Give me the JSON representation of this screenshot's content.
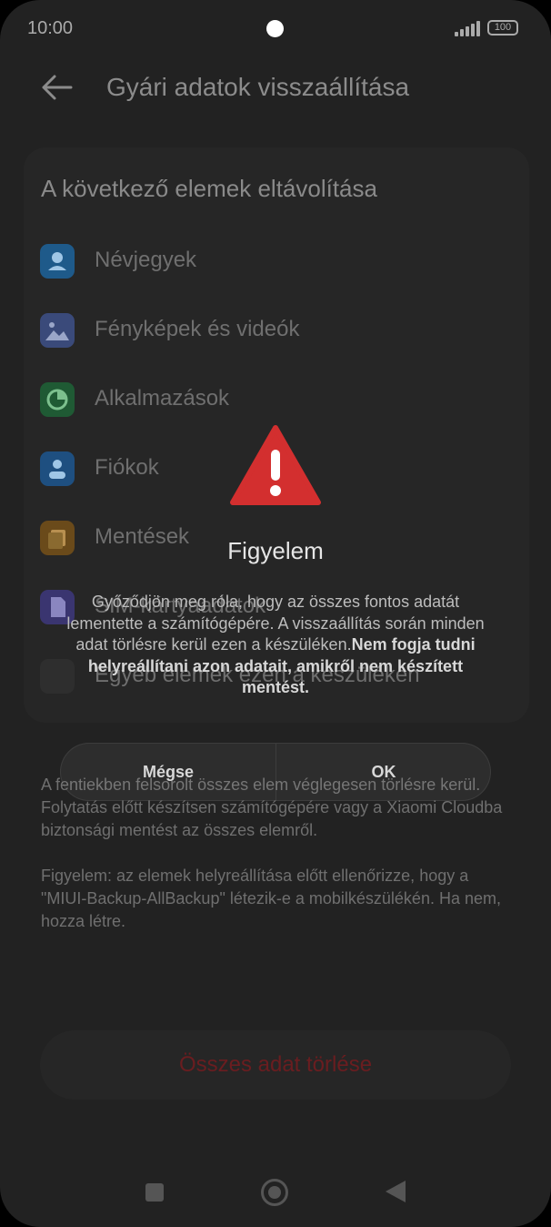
{
  "status_bar": {
    "time": "10:00",
    "battery": "100"
  },
  "header": {
    "title": "Gyári adatok visszaállítása"
  },
  "card": {
    "title": "A következő elemek eltávolítása",
    "items": [
      {
        "label": "Névjegyek",
        "icon": "contacts-icon",
        "color": "#1e5a8a"
      },
      {
        "label": "Fényképek és videók",
        "icon": "gallery-icon",
        "color": "#3a4a7a"
      },
      {
        "label": "Alkalmazások",
        "icon": "apps-icon",
        "color": "#1f5a34"
      },
      {
        "label": "Fiókok",
        "icon": "account-icon",
        "color": "#1e4f80"
      },
      {
        "label": "Mentések",
        "icon": "backup-icon",
        "color": "#6a4a1a"
      },
      {
        "label": "SIM-kártyaadatok",
        "icon": "sim-icon",
        "color": "#3a3570"
      },
      {
        "label": "Egyéb elemek ezen a készüléken",
        "icon": "other-icon",
        "color": "#2e2e2e"
      }
    ]
  },
  "info": {
    "p1": "A fentiekben felsorolt összes elem véglegesen törlésre kerül. Folytatás előtt készítsen számítógépére vagy a Xiaomi Cloudba biztonsági mentést az összes elemről.",
    "p2": "Figyelem: az elemek helyreállítása előtt ellenőrizze, hogy a \"MIUI-Backup-AllBackup\" létezik-e a mobilkészülékén. Ha nem, hozza létre."
  },
  "wipe_button": {
    "label": "Összes adat törlése"
  },
  "dialog": {
    "icon": "warning-icon",
    "title": "Figyelem",
    "message_plain": "Győződjön meg róla, hogy az összes fontos adatát lementette a számítógépére. A visszaállítás során minden adat törlésre kerül ezen a készüléken.",
    "message_bold": "Nem fogja tudni helyreállítani azon adatait, amikről nem készített mentést.",
    "cancel_label": "Mégse",
    "ok_label": "OK",
    "accent_color": "#d32f2f"
  }
}
